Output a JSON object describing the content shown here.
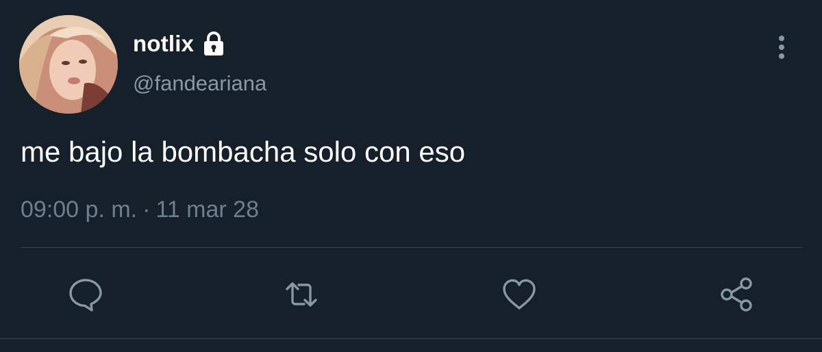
{
  "tweet": {
    "display_name": "notlix",
    "handle": "@fandeariana",
    "text": "me bajo la bombacha solo con eso",
    "time": "09:00 p. m.",
    "separator": "·",
    "date": "11 mar 28",
    "account_protected_icon": "lock-icon"
  },
  "actions": [
    {
      "name": "reply",
      "icon": "speech-bubble-icon"
    },
    {
      "name": "retweet",
      "icon": "retweet-arrows-icon"
    },
    {
      "name": "like",
      "icon": "heart-icon"
    },
    {
      "name": "share",
      "icon": "share-nodes-icon"
    }
  ],
  "colors": {
    "background": "#15202b",
    "primary_text": "#ffffff",
    "secondary_text": "#8899a6",
    "icon": "#8899a6",
    "divider": "#38444d"
  }
}
